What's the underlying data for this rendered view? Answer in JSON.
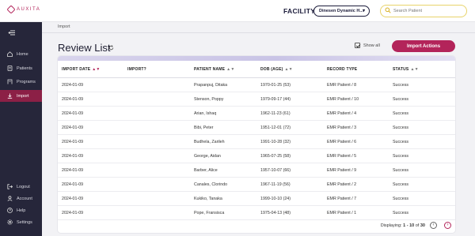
{
  "app": {
    "logo_text": "AUXITA"
  },
  "header": {
    "facility_label": "FACILITY",
    "facility_value": "Dinesen Dynamic H...",
    "search_placeholder": "Search Patient"
  },
  "sidebar": {
    "items": [
      {
        "label": "Home",
        "icon": "home-icon"
      },
      {
        "label": "Patients",
        "icon": "patients-icon"
      },
      {
        "label": "Programs",
        "icon": "programs-icon"
      },
      {
        "label": "Import",
        "icon": "import-icon",
        "active": true
      }
    ],
    "bottom_items": [
      {
        "label": "Logout",
        "icon": "logout-icon"
      },
      {
        "label": "Account",
        "icon": "account-icon"
      },
      {
        "label": "Help",
        "icon": "help-icon"
      },
      {
        "label": "Settings",
        "icon": "settings-icon"
      }
    ]
  },
  "breadcrumb": "Import",
  "page": {
    "title": "Review List",
    "show_all_label": "Show all",
    "show_all_checked": true,
    "import_actions_label": "Import Actions"
  },
  "table": {
    "columns": [
      "IMPORT DATE",
      "IMPORT?",
      "PATIENT NAME",
      "DOB (AGE)",
      "RECORD TYPE",
      "STATUS"
    ],
    "rows": [
      [
        "2024-01-09",
        "",
        "Prapanpuj, Ditaka",
        "1970-01-25 (53)",
        "EMR Patient / 8",
        "Success"
      ],
      [
        "2024-01-09",
        "",
        "Stenson, Poppy",
        "1979-09-17 (44)",
        "EMR Patient / 10",
        "Success"
      ],
      [
        "2024-01-09",
        "",
        "Arian, Ishaq",
        "1962-11-23 (61)",
        "EMR Patient / 4",
        "Success"
      ],
      [
        "2024-01-09",
        "",
        "Bibi, Peter",
        "1951-12-01 (72)",
        "EMR Patient / 3",
        "Success"
      ],
      [
        "2024-01-09",
        "",
        "Budhela, Zarileh",
        "1991-10-28 (32)",
        "EMR Patient / 6",
        "Success"
      ],
      [
        "2024-01-09",
        "",
        "George, Aidan",
        "1965-07-25 (58)",
        "EMR Patient / 5",
        "Success"
      ],
      [
        "2024-01-09",
        "",
        "Barber, Alice",
        "1957-10-07 (66)",
        "EMR Patient / 9",
        "Success"
      ],
      [
        "2024-01-09",
        "",
        "Canales, Clorindo",
        "1967-11-19 (56)",
        "EMR Patient / 2",
        "Success"
      ],
      [
        "2024-01-09",
        "",
        "Kukiko, Tanaka",
        "1999-10-10 (24)",
        "EMR Patient / 7",
        "Success"
      ],
      [
        "2024-01-09",
        "",
        "Pope, Fransisca",
        "1975-04-13 (48)",
        "EMR Patient / 1",
        "Success"
      ]
    ]
  },
  "pagination": {
    "prefix": "Displaying:",
    "range": "1 - 10",
    "of_label": "of",
    "total": "30"
  },
  "colors": {
    "accent": "#b3245a",
    "sidebar_bg": "#26263a",
    "active_nav": "#8c2046"
  }
}
